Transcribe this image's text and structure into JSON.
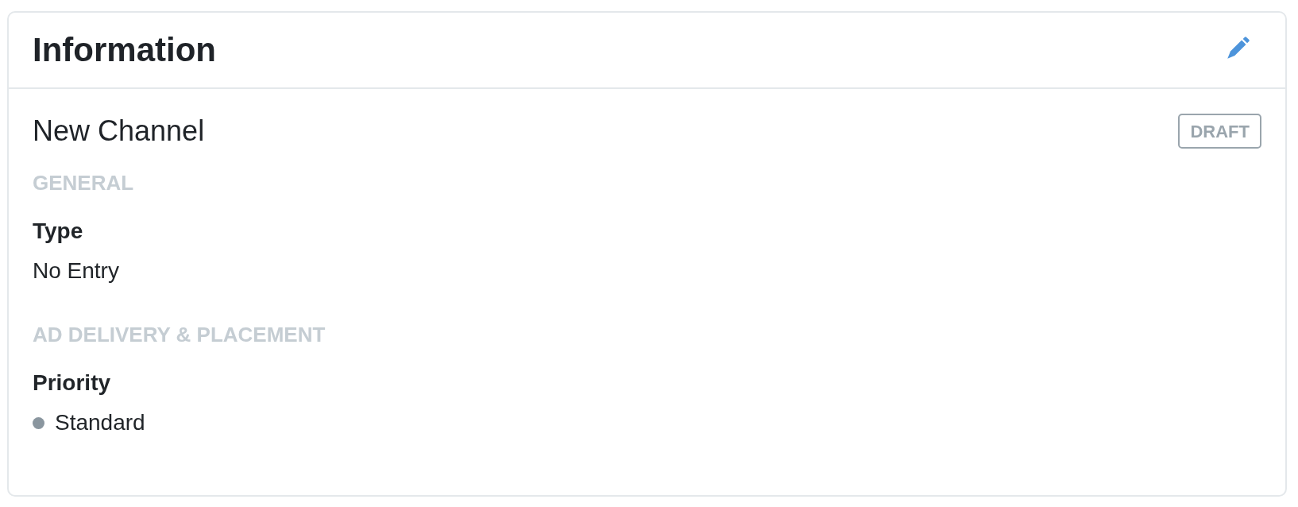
{
  "card": {
    "title": "Information"
  },
  "channel": {
    "name": "New Channel",
    "status": "DRAFT"
  },
  "sections": [
    {
      "heading": "GENERAL",
      "fields": [
        {
          "label": "Type",
          "value": "No Entry",
          "kind": "text"
        }
      ]
    },
    {
      "heading": "AD DELIVERY & PLACEMENT",
      "fields": [
        {
          "label": "Priority",
          "value": "Standard",
          "kind": "status",
          "color": "#8a969f"
        }
      ]
    }
  ]
}
